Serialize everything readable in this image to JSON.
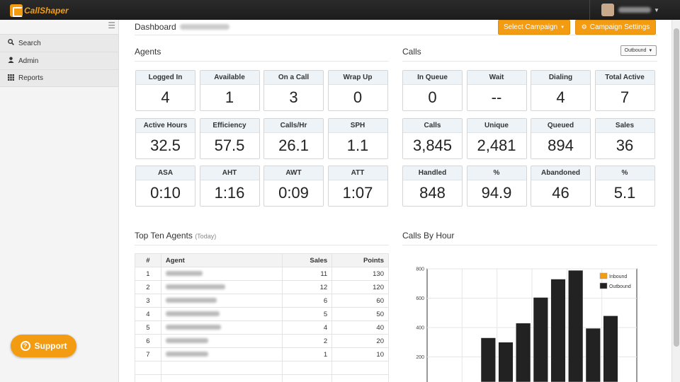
{
  "brand": {
    "logo_text": "CallShaper",
    "accent": "#f39c12"
  },
  "sidebar": {
    "toggle_icon": "menu-icon",
    "items": [
      {
        "label": "Search",
        "icon": "search-icon"
      },
      {
        "label": "Admin",
        "icon": "user-icon"
      },
      {
        "label": "Reports",
        "icon": "grid-icon"
      }
    ],
    "support_label": "Support"
  },
  "header": {
    "title": "Dashboard",
    "select_campaign_label": "Select Campaign",
    "campaign_settings_label": "Campaign Settings"
  },
  "agents": {
    "title": "Agents",
    "tiles": [
      {
        "label": "Logged In",
        "value": "4"
      },
      {
        "label": "Available",
        "value": "1"
      },
      {
        "label": "On a Call",
        "value": "3"
      },
      {
        "label": "Wrap Up",
        "value": "0"
      },
      {
        "label": "Active Hours",
        "value": "32.5"
      },
      {
        "label": "Efficiency",
        "value": "57.5"
      },
      {
        "label": "Calls/Hr",
        "value": "26.1"
      },
      {
        "label": "SPH",
        "value": "1.1"
      },
      {
        "label": "ASA",
        "value": "0:10"
      },
      {
        "label": "AHT",
        "value": "1:16"
      },
      {
        "label": "AWT",
        "value": "0:09"
      },
      {
        "label": "ATT",
        "value": "1:07"
      }
    ]
  },
  "calls": {
    "title": "Calls",
    "direction": "Outbound",
    "tiles": [
      {
        "label": "In Queue",
        "value": "0"
      },
      {
        "label": "Wait",
        "value": "--"
      },
      {
        "label": "Dialing",
        "value": "4"
      },
      {
        "label": "Total Active",
        "value": "7"
      },
      {
        "label": "Calls",
        "value": "3,845"
      },
      {
        "label": "Unique",
        "value": "2,481"
      },
      {
        "label": "Queued",
        "value": "894"
      },
      {
        "label": "Sales",
        "value": "36"
      },
      {
        "label": "Handled",
        "value": "848"
      },
      {
        "label": "%",
        "value": "94.9"
      },
      {
        "label": "Abandoned",
        "value": "46"
      },
      {
        "label": "%",
        "value": "5.1"
      }
    ]
  },
  "top_agents": {
    "title": "Top Ten Agents",
    "subtitle": "(Today)",
    "columns": [
      "#",
      "Agent",
      "Sales",
      "Points"
    ],
    "rows": [
      {
        "rank": "1",
        "sales": "11",
        "points": "130"
      },
      {
        "rank": "2",
        "sales": "12",
        "points": "120"
      },
      {
        "rank": "3",
        "sales": "6",
        "points": "60"
      },
      {
        "rank": "4",
        "sales": "5",
        "points": "50"
      },
      {
        "rank": "5",
        "sales": "4",
        "points": "40"
      },
      {
        "rank": "6",
        "sales": "2",
        "points": "20"
      },
      {
        "rank": "7",
        "sales": "1",
        "points": "10"
      }
    ]
  },
  "calls_by_hour": {
    "title": "Calls By Hour"
  },
  "chart_data": {
    "type": "bar",
    "title": "Calls By Hour",
    "xlabel": "",
    "ylabel": "",
    "ylim": [
      0,
      800
    ],
    "yticks": [
      200,
      400,
      600,
      800
    ],
    "legend": "top-right",
    "grid": true,
    "series": [
      {
        "name": "Inbound",
        "color": "#f39c12",
        "values": [
          0,
          0,
          0,
          0,
          0,
          0,
          0,
          0,
          0,
          0,
          0,
          0
        ]
      },
      {
        "name": "Outbound",
        "color": "#222222",
        "values": [
          0,
          0,
          0,
          330,
          300,
          430,
          605,
          730,
          790,
          395,
          480,
          0
        ]
      }
    ]
  }
}
